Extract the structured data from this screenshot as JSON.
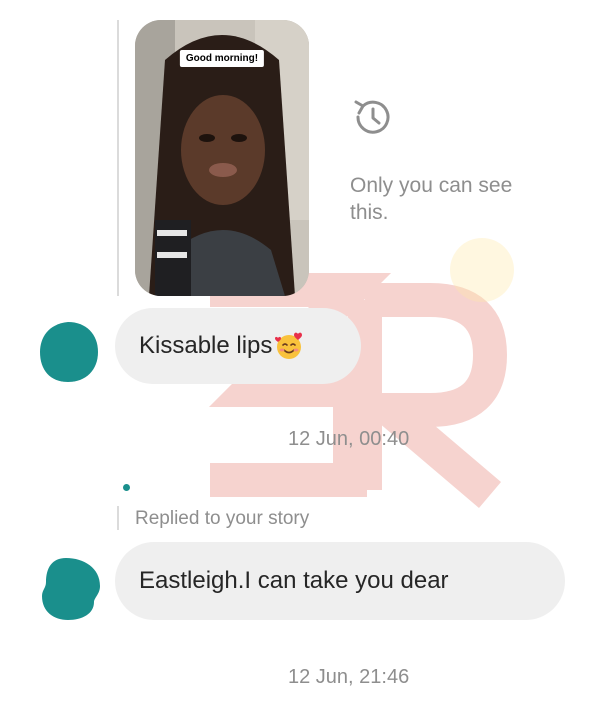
{
  "story": {
    "sticker_text": "Good morning!",
    "visibility_text": "Only you can see this.",
    "icon": "history-icon"
  },
  "messages": [
    {
      "text": "Kissable lips",
      "emoji": "smiling-face-with-hearts-icon",
      "timestamp": "12 Jun, 00:40"
    },
    {
      "reply_label": "Replied to your story",
      "text": "Eastleigh.I can take you dear",
      "timestamp": "12 Jun, 21:46"
    }
  ],
  "colors": {
    "avatar": "#1a8f8c",
    "bubble": "#efefef",
    "secondary_text": "#8e8e8e",
    "watermark": "#f3c9c4",
    "watermark_dot": "#ffe9a6"
  }
}
